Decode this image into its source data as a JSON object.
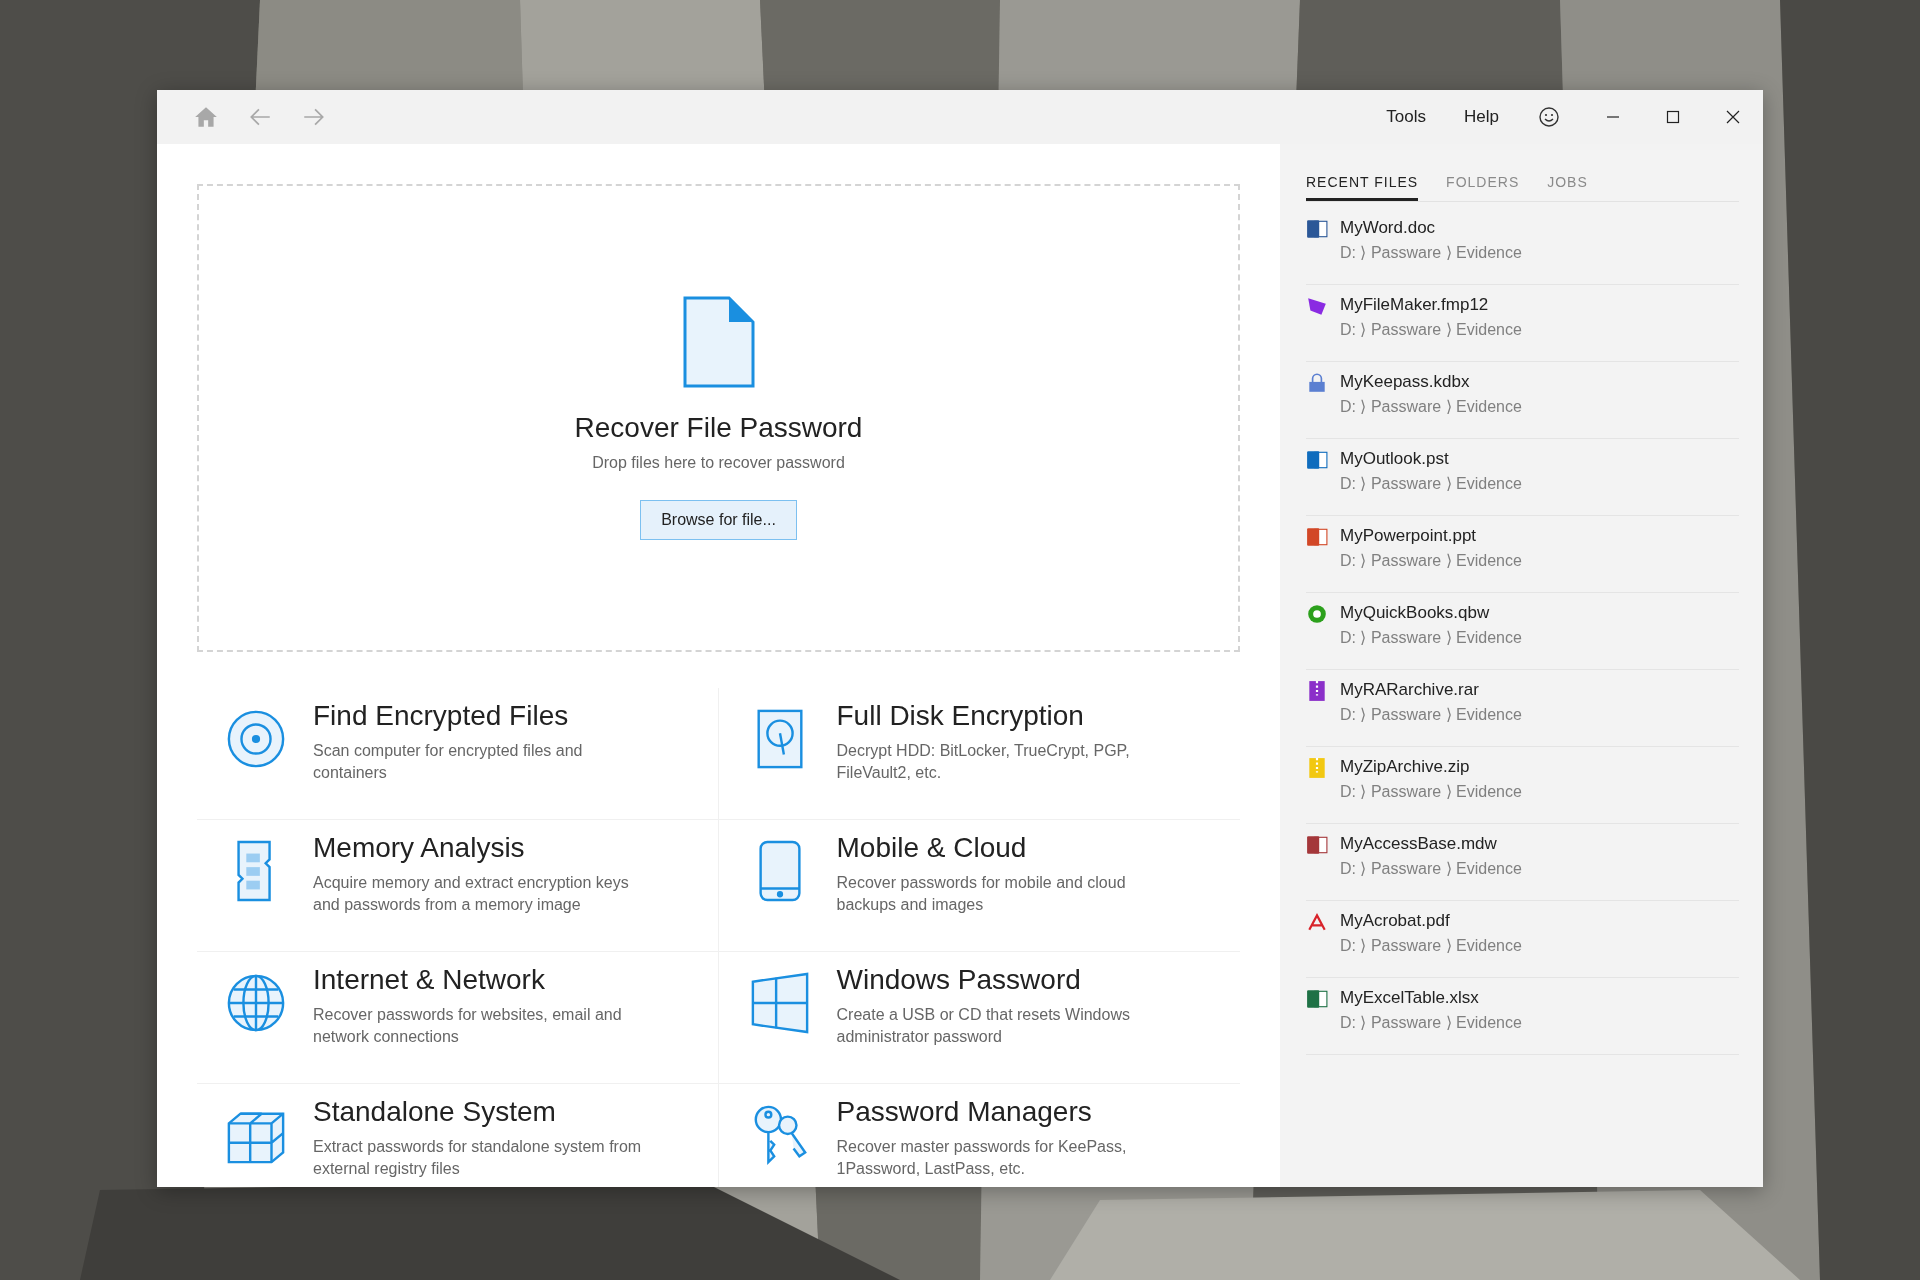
{
  "toolbar": {
    "menus": [
      "Tools",
      "Help"
    ]
  },
  "drop_zone": {
    "title": "Recover File Password",
    "subtitle": "Drop files here to recover password",
    "button": "Browse for file..."
  },
  "features": [
    {
      "kind": "disc",
      "title": "Find Encrypted Files",
      "description": "Scan computer for encrypted files and containers"
    },
    {
      "kind": "disk",
      "title": "Full Disk Encryption",
      "description": "Decrypt HDD: BitLocker, TrueCrypt, PGP, FileVault2, etc."
    },
    {
      "kind": "memory",
      "title": "Memory Analysis",
      "description": "Acquire memory and extract encryption keys and passwords from a memory image"
    },
    {
      "kind": "mobile",
      "title": "Mobile & Cloud",
      "description": "Recover passwords for mobile and cloud backups and images"
    },
    {
      "kind": "globe",
      "title": "Internet & Network",
      "description": "Recover passwords for websites, email and network connections"
    },
    {
      "kind": "windows",
      "title": "Windows Password",
      "description": "Create a USB or CD that resets Windows administrator password"
    },
    {
      "kind": "cubes",
      "title": "Standalone System",
      "description": "Extract passwords for standalone system from external registry files"
    },
    {
      "kind": "keys",
      "title": "Password Managers",
      "description": "Recover master passwords for KeePass, 1Password, LastPass, etc."
    }
  ],
  "sidebar": {
    "tabs": [
      {
        "label": "RECENT FILES",
        "selected": true
      },
      {
        "label": "FOLDERS",
        "selected": false
      },
      {
        "label": "JOBS",
        "selected": false
      }
    ],
    "files": [
      {
        "kind": "word",
        "name": "MyWord.doc",
        "path": "D: ⟩ Passware ⟩ Evidence"
      },
      {
        "kind": "filemaker",
        "name": "MyFileMaker.fmp12",
        "path": "D: ⟩ Passware ⟩ Evidence"
      },
      {
        "kind": "keepass",
        "name": "MyKeepass.kdbx",
        "path": "D: ⟩ Passware ⟩ Evidence"
      },
      {
        "kind": "outlook",
        "name": "MyOutlook.pst",
        "path": "D: ⟩ Passware ⟩ Evidence"
      },
      {
        "kind": "powerpoint",
        "name": "MyPowerpoint.ppt",
        "path": "D: ⟩ Passware ⟩ Evidence"
      },
      {
        "kind": "quickbooks",
        "name": "MyQuickBooks.qbw",
        "path": "D: ⟩ Passware ⟩ Evidence"
      },
      {
        "kind": "rar",
        "name": "MyRARarchive.rar",
        "path": "D: ⟩ Passware ⟩ Evidence"
      },
      {
        "kind": "zip",
        "name": "MyZipArchive.zip",
        "path": "D: ⟩ Passware ⟩ Evidence"
      },
      {
        "kind": "access",
        "name": "MyAccessBase.mdw",
        "path": "D: ⟩ Passware ⟩ Evidence"
      },
      {
        "kind": "acrobat",
        "name": "MyAcrobat.pdf",
        "path": "D: ⟩ Passware ⟩ Evidence"
      },
      {
        "kind": "excel",
        "name": "MyExcelTable.xlsx",
        "path": "D: ⟩ Passware ⟩ Evidence"
      }
    ]
  }
}
